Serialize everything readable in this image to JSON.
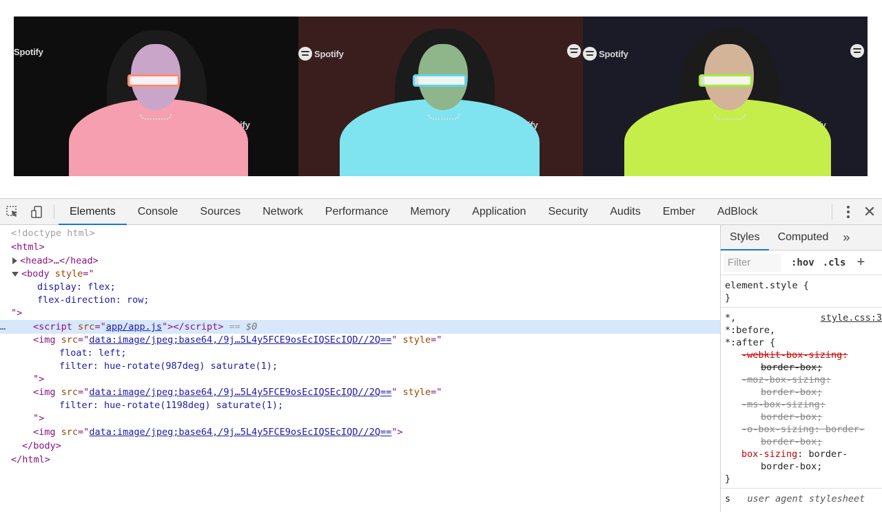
{
  "preview": {
    "brand_text": "Spotify",
    "photos": [
      {
        "tint": "#f59fb0",
        "bg": "#0e0e0e",
        "glasses": "#ff8a6a"
      },
      {
        "tint": "#7fe3f0",
        "bg": "#3a1d1d",
        "glasses": "#5fd4f0"
      },
      {
        "tint": "#c6ee4a",
        "bg": "#1b1b27",
        "glasses": "#9cf03a"
      }
    ]
  },
  "toolbar": {
    "tabs": [
      "Elements",
      "Console",
      "Sources",
      "Network",
      "Performance",
      "Memory",
      "Application",
      "Security",
      "Audits",
      "Ember",
      "AdBlock"
    ],
    "active_tab": "Elements"
  },
  "elements": {
    "doctype": "<!doctype html>",
    "html_open": "<html>",
    "head_line": "<head>…</head>",
    "body_tag": "<body",
    "style_attr": "style",
    "body_css": [
      "display: flex;",
      "flex-direction: row;"
    ],
    "script_src": "app/app.js",
    "selected_marker": "== $0",
    "img_src": "data:image/jpeg;base64,/9j…5L4y5FCE9osEcIQSEcIQD//2Q==",
    "img1_css": [
      "float: left;",
      "filter: hue-rotate(987deg) saturate(1);"
    ],
    "img2_css": [
      "filter: hue-rotate(1198deg) saturate(1);"
    ],
    "body_close": "</body>",
    "html_close": "</html>"
  },
  "styles": {
    "tabs": [
      "Styles",
      "Computed"
    ],
    "more": "»",
    "filter_placeholder": "Filter",
    "hov": ":hov",
    "cls": ".cls",
    "plus": "+",
    "element_style": "element.style {",
    "close_brace": "}",
    "selector": [
      "*,",
      "*:before,",
      "*:after {"
    ],
    "source": "style.css:3",
    "props": [
      {
        "name": "-webkit-box-sizing",
        "value": "border-box;"
      },
      {
        "name": "-moz-box-sizing",
        "value": "border-box;"
      },
      {
        "name": "-ms-box-sizing",
        "value": "border-box;"
      },
      {
        "name": "-o-box-sizing",
        "value": "border-box;"
      },
      {
        "name": "box-sizing",
        "value": "border-box;"
      }
    ],
    "ua_selector": "s",
    "ua_label": "user agent stylesheet"
  }
}
